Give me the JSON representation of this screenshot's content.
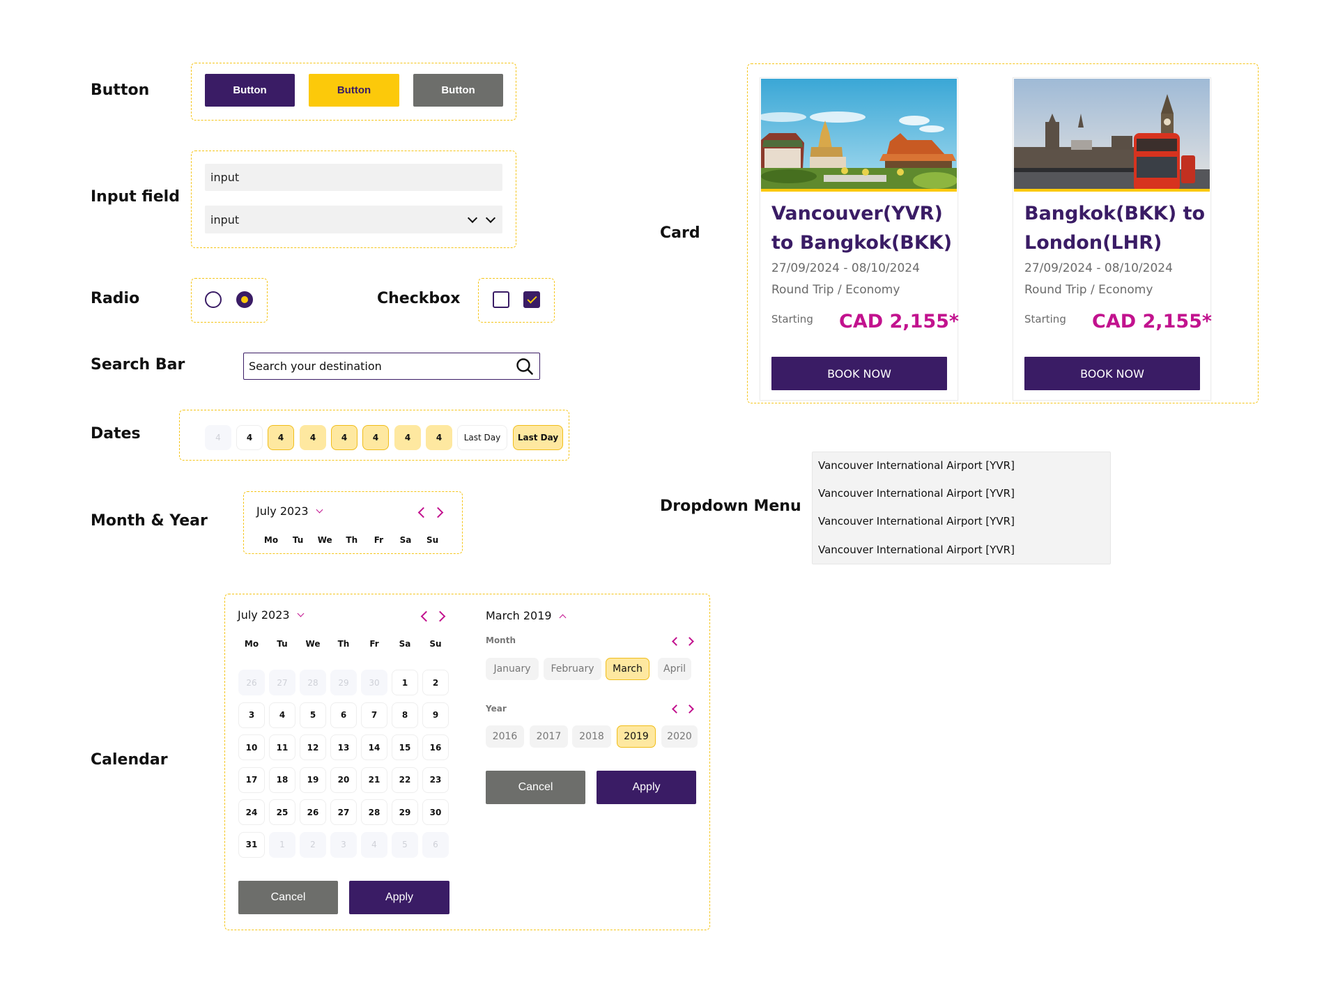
{
  "labels": {
    "button": "Button",
    "input_field": "Input field",
    "radio": "Radio",
    "checkbox": "Checkbox",
    "search_bar": "Search Bar",
    "dates": "Dates",
    "month_year": "Month & Year",
    "calendar": "Calendar",
    "card": "Card",
    "dropdown_menu": "Dropdown Menu"
  },
  "colors": {
    "primary": "#3a1c65",
    "accent_yellow": "#fcc90a",
    "grey": "#6d6e6b",
    "price_magenta": "#c2128e",
    "dashed_outline": "#f5c518"
  },
  "buttons": [
    {
      "label": "Button",
      "variant": "primary"
    },
    {
      "label": "Button",
      "variant": "yellow"
    },
    {
      "label": "Button",
      "variant": "grey"
    }
  ],
  "inputs": {
    "text_value": "input",
    "select_value": "input",
    "select_icons": [
      "chevron-down-icon",
      "chevron-down-icon"
    ]
  },
  "radios": [
    {
      "checked": false
    },
    {
      "checked": true
    }
  ],
  "checkboxes": [
    {
      "checked": false
    },
    {
      "checked": true
    }
  ],
  "search": {
    "placeholder": "Search your destination",
    "icon": "search-icon"
  },
  "dates": {
    "chips": [
      {
        "label": "4",
        "state": "disabled"
      },
      {
        "label": "4",
        "state": "default"
      },
      {
        "label": "4",
        "state": "selected-outline"
      },
      {
        "label": "4",
        "state": "in-range"
      },
      {
        "label": "4",
        "state": "selected-outline"
      },
      {
        "label": "4",
        "state": "selected-outline"
      },
      {
        "label": "4",
        "state": "in-range"
      },
      {
        "label": "4",
        "state": "in-range"
      },
      {
        "label": "Last Day",
        "state": "default"
      },
      {
        "label": "Last Day",
        "state": "selected-outline"
      }
    ]
  },
  "month_year_header": {
    "title": "July 2023",
    "weekdays": [
      "Mo",
      "Tu",
      "We",
      "Th",
      "Fr",
      "Sa",
      "Su"
    ]
  },
  "calendar": {
    "title": "July 2023",
    "weekdays": [
      "Mo",
      "Tu",
      "We",
      "Th",
      "Fr",
      "Sa",
      "Su"
    ],
    "weeks": [
      [
        {
          "d": "26",
          "m": true
        },
        {
          "d": "27",
          "m": true
        },
        {
          "d": "28",
          "m": true
        },
        {
          "d": "29",
          "m": true
        },
        {
          "d": "30",
          "m": true
        },
        {
          "d": "1"
        },
        {
          "d": "2"
        }
      ],
      [
        {
          "d": "3"
        },
        {
          "d": "4"
        },
        {
          "d": "5"
        },
        {
          "d": "6"
        },
        {
          "d": "7"
        },
        {
          "d": "8"
        },
        {
          "d": "9"
        }
      ],
      [
        {
          "d": "10"
        },
        {
          "d": "11"
        },
        {
          "d": "12"
        },
        {
          "d": "13"
        },
        {
          "d": "14"
        },
        {
          "d": "15"
        },
        {
          "d": "16"
        }
      ],
      [
        {
          "d": "17"
        },
        {
          "d": "18"
        },
        {
          "d": "19"
        },
        {
          "d": "20"
        },
        {
          "d": "21"
        },
        {
          "d": "22"
        },
        {
          "d": "23"
        }
      ],
      [
        {
          "d": "24"
        },
        {
          "d": "25"
        },
        {
          "d": "26"
        },
        {
          "d": "27"
        },
        {
          "d": "28"
        },
        {
          "d": "29"
        },
        {
          "d": "30"
        }
      ],
      [
        {
          "d": "31"
        },
        {
          "d": "1",
          "m": true
        },
        {
          "d": "2",
          "m": true
        },
        {
          "d": "3",
          "m": true
        },
        {
          "d": "4",
          "m": true
        },
        {
          "d": "5",
          "m": true
        },
        {
          "d": "6",
          "m": true
        }
      ]
    ],
    "cancel_label": "Cancel",
    "apply_label": "Apply",
    "picker": {
      "title": "March 2019",
      "month_label": "Month",
      "months": [
        {
          "label": "January",
          "selected": false
        },
        {
          "label": "February",
          "selected": false
        },
        {
          "label": "March",
          "selected": true
        },
        {
          "label": "April",
          "selected": false
        }
      ],
      "year_label": "Year",
      "years": [
        {
          "label": "2016",
          "selected": false
        },
        {
          "label": "2017",
          "selected": false
        },
        {
          "label": "2018",
          "selected": false
        },
        {
          "label": "2019",
          "selected": true
        },
        {
          "label": "2020",
          "selected": false
        }
      ],
      "cancel_label": "Cancel",
      "apply_label": "Apply"
    }
  },
  "cards": [
    {
      "image": "bangkok-temple-photo",
      "title_line1": "Vancouver(YVR)",
      "title_line2": "to Bangkok(BKK)",
      "dates": "27/09/2024 - 08/10/2024",
      "trip": "Round Trip / Economy",
      "starting_label": "Starting",
      "price": "CAD 2,155*",
      "cta": "BOOK NOW"
    },
    {
      "image": "london-westminster-photo",
      "title_line1": "Bangkok(BKK) to",
      "title_line2": "London(LHR)",
      "dates": "27/09/2024 - 08/10/2024",
      "trip": "Round Trip / Economy",
      "starting_label": "Starting",
      "price": "CAD 2,155*",
      "cta": "BOOK NOW"
    }
  ],
  "dropdown": {
    "items": [
      "Vancouver International Airport [YVR]",
      "Vancouver International Airport [YVR]",
      "Vancouver International Airport [YVR]",
      "Vancouver International Airport [YVR]"
    ]
  }
}
